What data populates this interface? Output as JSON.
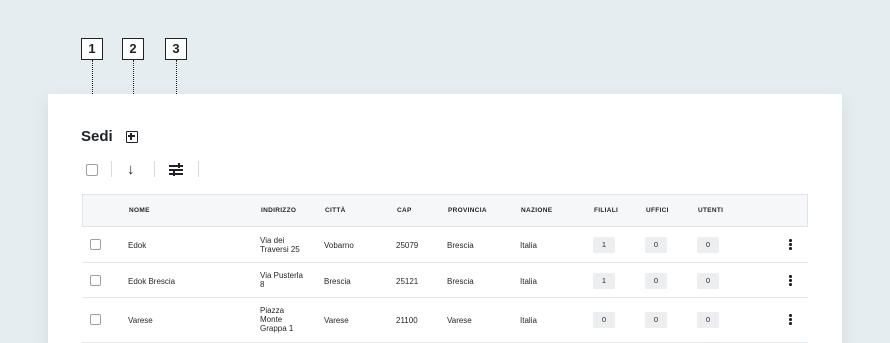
{
  "callouts": [
    "1",
    "2",
    "3"
  ],
  "page": {
    "title": "Sedi"
  },
  "icons": {
    "add": "add-box-icon",
    "sort": "arrow-down-icon",
    "filter": "sliders-icon",
    "more": "kebab-menu-icon"
  },
  "table": {
    "headers": [
      "NOME",
      "INDIRIZZO",
      "CITTÀ",
      "CAP",
      "PROVINCIA",
      "NAZIONE",
      "FILIALI",
      "UFFICI",
      "UTENTI"
    ],
    "rows": [
      {
        "nome": "Edok",
        "indirizzo": [
          "Via dei",
          "Traversi 25"
        ],
        "citta": "Vobarno",
        "cap": "25079",
        "provincia": "Brescia",
        "nazione": "Italia",
        "filiali": "1",
        "uffici": "0",
        "utenti": "0"
      },
      {
        "nome": "Edok Brescia",
        "indirizzo": [
          "Via Pusterla",
          "8"
        ],
        "citta": "Brescia",
        "cap": "25121",
        "provincia": "Brescia",
        "nazione": "Italia",
        "filiali": "1",
        "uffici": "0",
        "utenti": "0"
      },
      {
        "nome": "Varese",
        "indirizzo": [
          "Piazza",
          "Monte",
          "Grappa 1"
        ],
        "citta": "Varese",
        "cap": "21100",
        "provincia": "Varese",
        "nazione": "Italia",
        "filiali": "0",
        "uffici": "0",
        "utenti": "0"
      }
    ]
  }
}
